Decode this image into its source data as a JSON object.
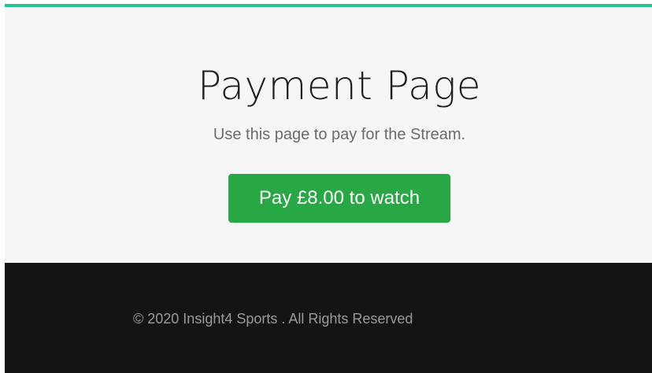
{
  "hero": {
    "title": "Payment Page",
    "subtitle": "Use this page to pay for the Stream.",
    "pay_button_label": "Pay £8.00 to watch"
  },
  "footer": {
    "copyright": "© 2020 Insight4 Sports . All Rights Reserved"
  },
  "colors": {
    "accent": "#23c48e",
    "button": "#28a745",
    "hero_background": "#f6f6f6",
    "footer_background": "#141414"
  }
}
